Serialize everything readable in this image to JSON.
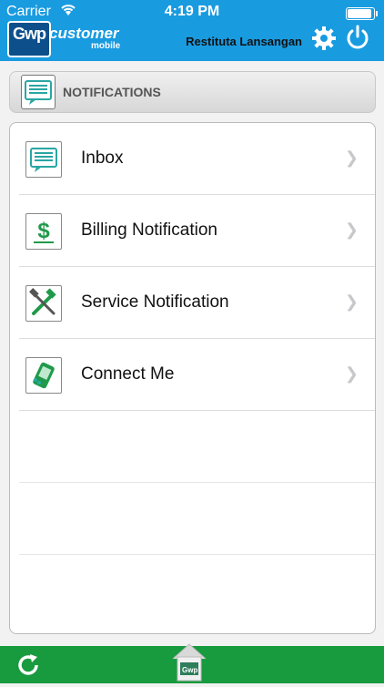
{
  "status": {
    "carrier": "Carrier",
    "time": "4:19 PM"
  },
  "header": {
    "logo_badge": "Gwp",
    "logo_word": "customer",
    "logo_sub": "mobile",
    "user_name": "Restituta Lansangan"
  },
  "section": {
    "title": "NOTIFICATIONS"
  },
  "menu": {
    "items": [
      {
        "label": "Inbox",
        "icon": "inbox-icon"
      },
      {
        "label": "Billing Notification",
        "icon": "dollar-icon"
      },
      {
        "label": "Service Notification",
        "icon": "tools-icon"
      },
      {
        "label": "Connect Me",
        "icon": "phone-icon"
      }
    ]
  },
  "footer": {
    "home_label": "Gwp"
  },
  "colors": {
    "header_bg": "#199be0",
    "footer_bg": "#189a3e",
    "icon_teal": "#2aa6a3",
    "icon_green": "#1f9a4a"
  }
}
